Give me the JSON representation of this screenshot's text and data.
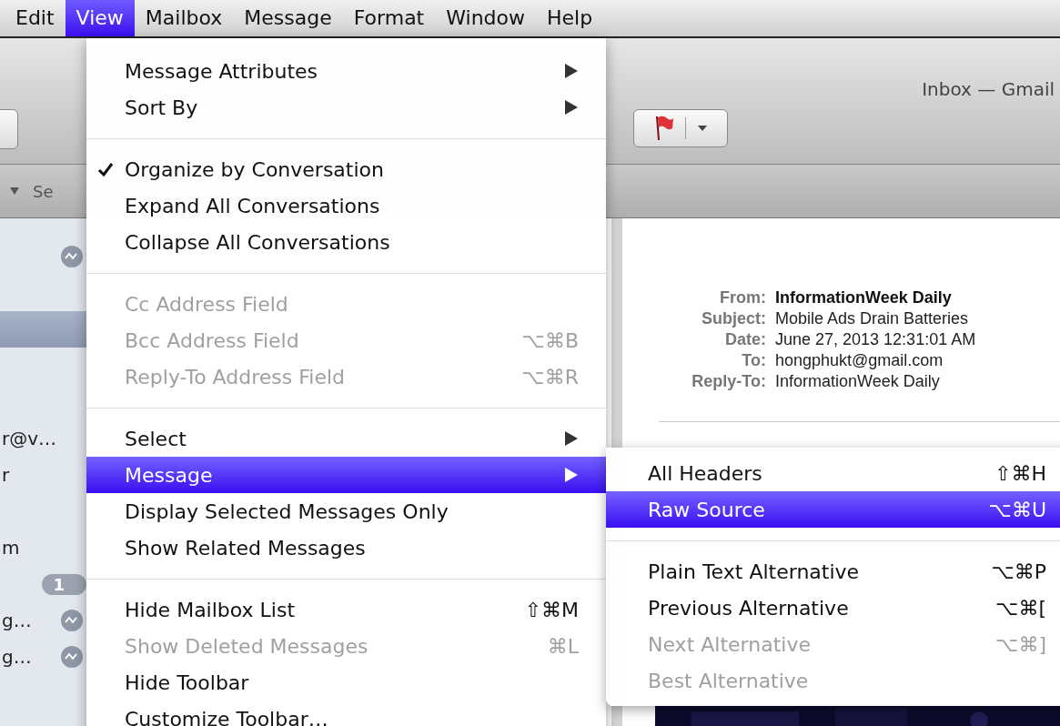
{
  "menu_bar": [
    {
      "label": "Edit",
      "selected": false
    },
    {
      "label": "View",
      "selected": true
    },
    {
      "label": "Mailbox",
      "selected": false
    },
    {
      "label": "Message",
      "selected": false
    },
    {
      "label": "Format",
      "selected": false
    },
    {
      "label": "Window",
      "selected": false
    },
    {
      "label": "Help",
      "selected": false
    }
  ],
  "window": {
    "title": "Inbox — Gmail"
  },
  "column_header": {
    "label": "Se"
  },
  "sidebar": {
    "rows": [
      {
        "kind": "thread"
      },
      {
        "kind": "blank"
      },
      {
        "kind": "selected"
      },
      {
        "kind": "blank"
      },
      {
        "kind": "blank"
      },
      {
        "kind": "text",
        "text": "r@v…"
      },
      {
        "kind": "text",
        "text": "r"
      },
      {
        "kind": "blank"
      },
      {
        "kind": "text",
        "text": "m"
      },
      {
        "kind": "count",
        "text": "1"
      },
      {
        "kind": "thread",
        "text": "g…"
      },
      {
        "kind": "thread",
        "text": "g…"
      }
    ]
  },
  "message_header": {
    "fields": [
      {
        "label": "From:",
        "value": "InformationWeek Daily",
        "emphasized": true
      },
      {
        "label": "Subject:",
        "value": "Mobile Ads Drain Batteries",
        "emphasized": false
      },
      {
        "label": "Date:",
        "value": "June 27, 2013 12:31:01 AM",
        "emphasized": false
      },
      {
        "label": "To:",
        "value": "hongphukt@gmail.com",
        "emphasized": false
      },
      {
        "label": "Reply-To:",
        "value": "InformationWeek Daily",
        "emphasized": false
      }
    ]
  },
  "view_menu": {
    "items": [
      {
        "kind": "item",
        "label": "Message Attributes",
        "checked": false,
        "disabled": false,
        "selected": false,
        "submenu": true
      },
      {
        "kind": "item",
        "label": "Sort By",
        "checked": false,
        "disabled": false,
        "selected": false,
        "submenu": true
      },
      {
        "kind": "separator"
      },
      {
        "kind": "item",
        "label": "Organize by Conversation",
        "checked": true,
        "disabled": false,
        "selected": false,
        "submenu": false
      },
      {
        "kind": "item",
        "label": "Expand All Conversations",
        "checked": false,
        "disabled": false,
        "selected": false,
        "submenu": false
      },
      {
        "kind": "item",
        "label": "Collapse All Conversations",
        "checked": false,
        "disabled": false,
        "selected": false,
        "submenu": false
      },
      {
        "kind": "separator"
      },
      {
        "kind": "item",
        "label": "Cc Address Field",
        "checked": false,
        "disabled": true,
        "selected": false,
        "submenu": false
      },
      {
        "kind": "item",
        "label": "Bcc Address Field",
        "checked": false,
        "disabled": true,
        "selected": false,
        "submenu": false,
        "shortcut": "⌥⌘B"
      },
      {
        "kind": "item",
        "label": "Reply-To Address Field",
        "checked": false,
        "disabled": true,
        "selected": false,
        "submenu": false,
        "shortcut": "⌥⌘R"
      },
      {
        "kind": "separator"
      },
      {
        "kind": "item",
        "label": "Select",
        "checked": false,
        "disabled": false,
        "selected": false,
        "submenu": true
      },
      {
        "kind": "item",
        "label": "Message",
        "checked": false,
        "disabled": false,
        "selected": true,
        "submenu": true
      },
      {
        "kind": "item",
        "label": "Display Selected Messages Only",
        "checked": false,
        "disabled": false,
        "selected": false,
        "submenu": false
      },
      {
        "kind": "item",
        "label": "Show Related Messages",
        "checked": false,
        "disabled": false,
        "selected": false,
        "submenu": false
      },
      {
        "kind": "separator"
      },
      {
        "kind": "item",
        "label": "Hide Mailbox List",
        "checked": false,
        "disabled": false,
        "selected": false,
        "submenu": false,
        "shortcut": "⇧⌘M"
      },
      {
        "kind": "item",
        "label": "Show Deleted Messages",
        "checked": false,
        "disabled": true,
        "selected": false,
        "submenu": false,
        "shortcut": "⌘L"
      },
      {
        "kind": "item",
        "label": "Hide Toolbar",
        "checked": false,
        "disabled": false,
        "selected": false,
        "submenu": false
      },
      {
        "kind": "item",
        "label": "Customize Toolbar…",
        "checked": false,
        "disabled": false,
        "selected": false,
        "submenu": false
      }
    ]
  },
  "message_submenu": {
    "items": [
      {
        "kind": "item",
        "label": "All Headers",
        "checked": false,
        "disabled": false,
        "selected": false,
        "submenu": false,
        "shortcut": "⇧⌘H"
      },
      {
        "kind": "item",
        "label": "Raw Source",
        "checked": false,
        "disabled": false,
        "selected": true,
        "submenu": false,
        "shortcut": "⌥⌘U"
      },
      {
        "kind": "separator"
      },
      {
        "kind": "item",
        "label": "Plain Text Alternative",
        "checked": false,
        "disabled": false,
        "selected": false,
        "submenu": false,
        "shortcut": "⌥⌘P"
      },
      {
        "kind": "item",
        "label": "Previous Alternative",
        "checked": false,
        "disabled": false,
        "selected": false,
        "submenu": false,
        "shortcut": "⌥⌘["
      },
      {
        "kind": "item",
        "label": "Next Alternative",
        "checked": false,
        "disabled": true,
        "selected": false,
        "submenu": false,
        "shortcut": "⌥⌘]"
      },
      {
        "kind": "item",
        "label": "Best Alternative",
        "checked": false,
        "disabled": true,
        "selected": false,
        "submenu": false
      }
    ]
  }
}
